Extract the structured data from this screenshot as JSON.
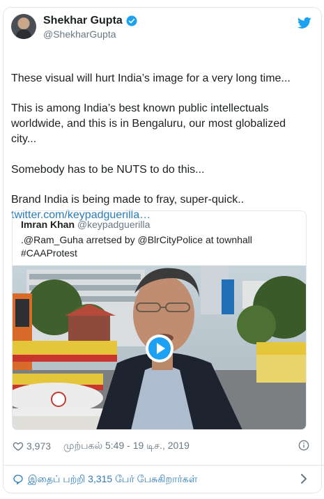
{
  "author": {
    "name": "Shekhar Gupta",
    "handle": "@ShekharGupta"
  },
  "tweet": {
    "text": "These visual will hurt India’s image for a very long time...\n\nThis is among India’s best known public intellectuals worldwide, and this is in Bengaluru, our most globalized city...\n\nSomebody has to be NUTS to do this...\n\nBrand India is being made to fray, super-quick..",
    "link": "twitter.com/keypadguerilla…"
  },
  "quoted": {
    "name": "Imran Khan",
    "handle": "@keypadguerilla",
    "text": ".@Ram_Guha arretsed by @BlrCityPolice at townhall\n#CAAProtest"
  },
  "stats": {
    "likes": "3,973",
    "timestamp": "முற்பகல் 5:49 - 19 டிச., 2019"
  },
  "footer": {
    "conversation": "இதைப் பற்றி 3,315 பேர் பேசுகிறார்கள்"
  },
  "icons": {
    "verified": "verified-badge-icon",
    "brand": "twitter-bird-icon",
    "like": "heart-icon",
    "info": "info-icon",
    "reply": "speech-bubble-icon",
    "next": "chevron-right-icon",
    "play": "play-icon"
  },
  "colors": {
    "accent": "#1da1f2",
    "link": "#2b7bb9",
    "secondary_text": "#697882",
    "border": "#e1e8ed"
  }
}
